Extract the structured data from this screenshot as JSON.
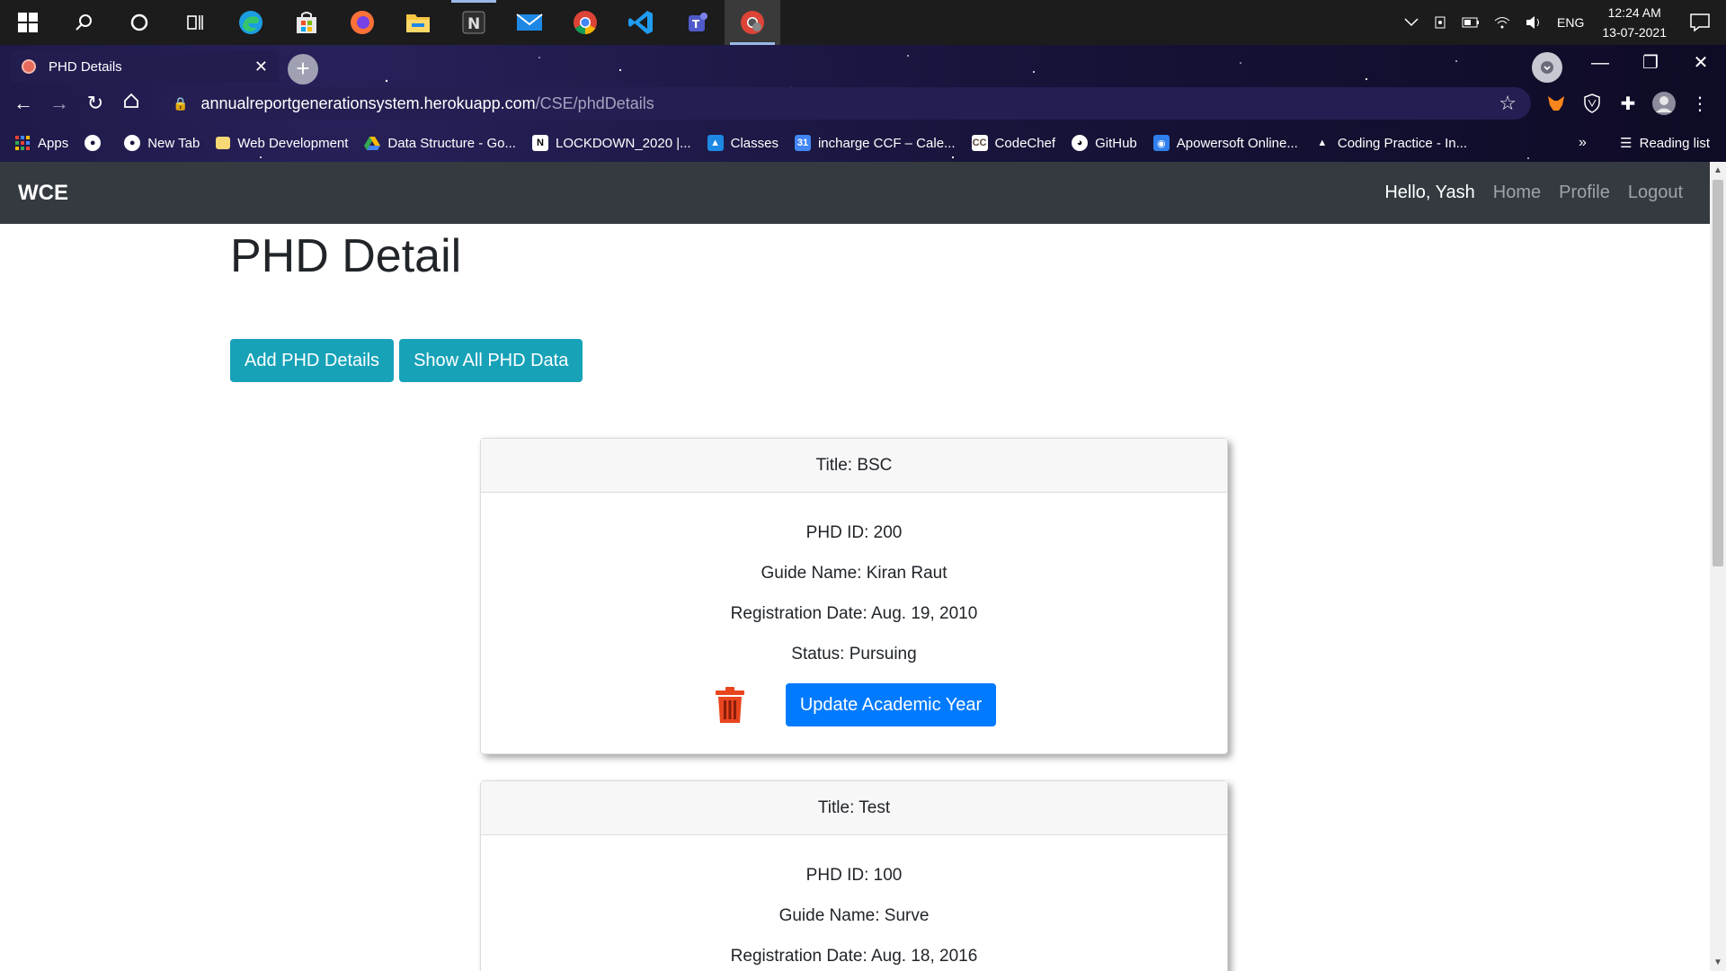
{
  "taskbar": {
    "icons": [
      "windows-start-icon",
      "search-icon",
      "cortana-icon",
      "task-view-icon",
      "edge-icon",
      "store-icon",
      "firefox-icon",
      "file-explorer-icon",
      "notion-icon",
      "mail-icon",
      "chrome-icon",
      "vscode-icon",
      "teams-icon",
      "chrome-app-icon"
    ],
    "language": "ENG",
    "time": "12:24 AM",
    "date": "13-07-2021"
  },
  "browser": {
    "tab_title": "PHD Details",
    "url_host": "annualreportgenerationsystem.herokuapp.com",
    "url_path": "/CSE/phdDetails",
    "bookmarks": [
      {
        "label": "Apps"
      },
      {
        "label": "New Tab"
      },
      {
        "label": "Web Development"
      },
      {
        "label": "Data Structure - Go..."
      },
      {
        "label": "LOCKDOWN_2020 |..."
      },
      {
        "label": "Classes"
      },
      {
        "label": "incharge CCF – Cale..."
      },
      {
        "label": "CodeChef"
      },
      {
        "label": "GitHub"
      },
      {
        "label": "Apowersoft Online..."
      },
      {
        "label": "Coding Practice - In..."
      }
    ],
    "reading_list": "Reading list"
  },
  "navbar": {
    "brand": "WCE",
    "greeting": "Hello, Yash",
    "links": [
      "Home",
      "Profile",
      "Logout"
    ]
  },
  "main": {
    "title": "PHD Detail",
    "add_button": "Add PHD Details",
    "show_button": "Show All PHD Data",
    "records": [
      {
        "title": "Title: BSC",
        "phd_id": "PHD ID: 200",
        "guide": "Guide Name: Kiran Raut",
        "reg_date": "Registration Date: Aug. 19, 2010",
        "status": "Status: Pursuing",
        "update_button": "Update Academic Year"
      },
      {
        "title": "Title: Test",
        "phd_id": "PHD ID: 100",
        "guide": "Guide Name: Surve",
        "reg_date": "Registration Date: Aug. 18, 2016"
      }
    ]
  },
  "colors": {
    "navbar_bg": "#343a40",
    "info_button": "#17a2b8",
    "primary_button": "#007bff",
    "trash_icon": "#e8451e"
  }
}
